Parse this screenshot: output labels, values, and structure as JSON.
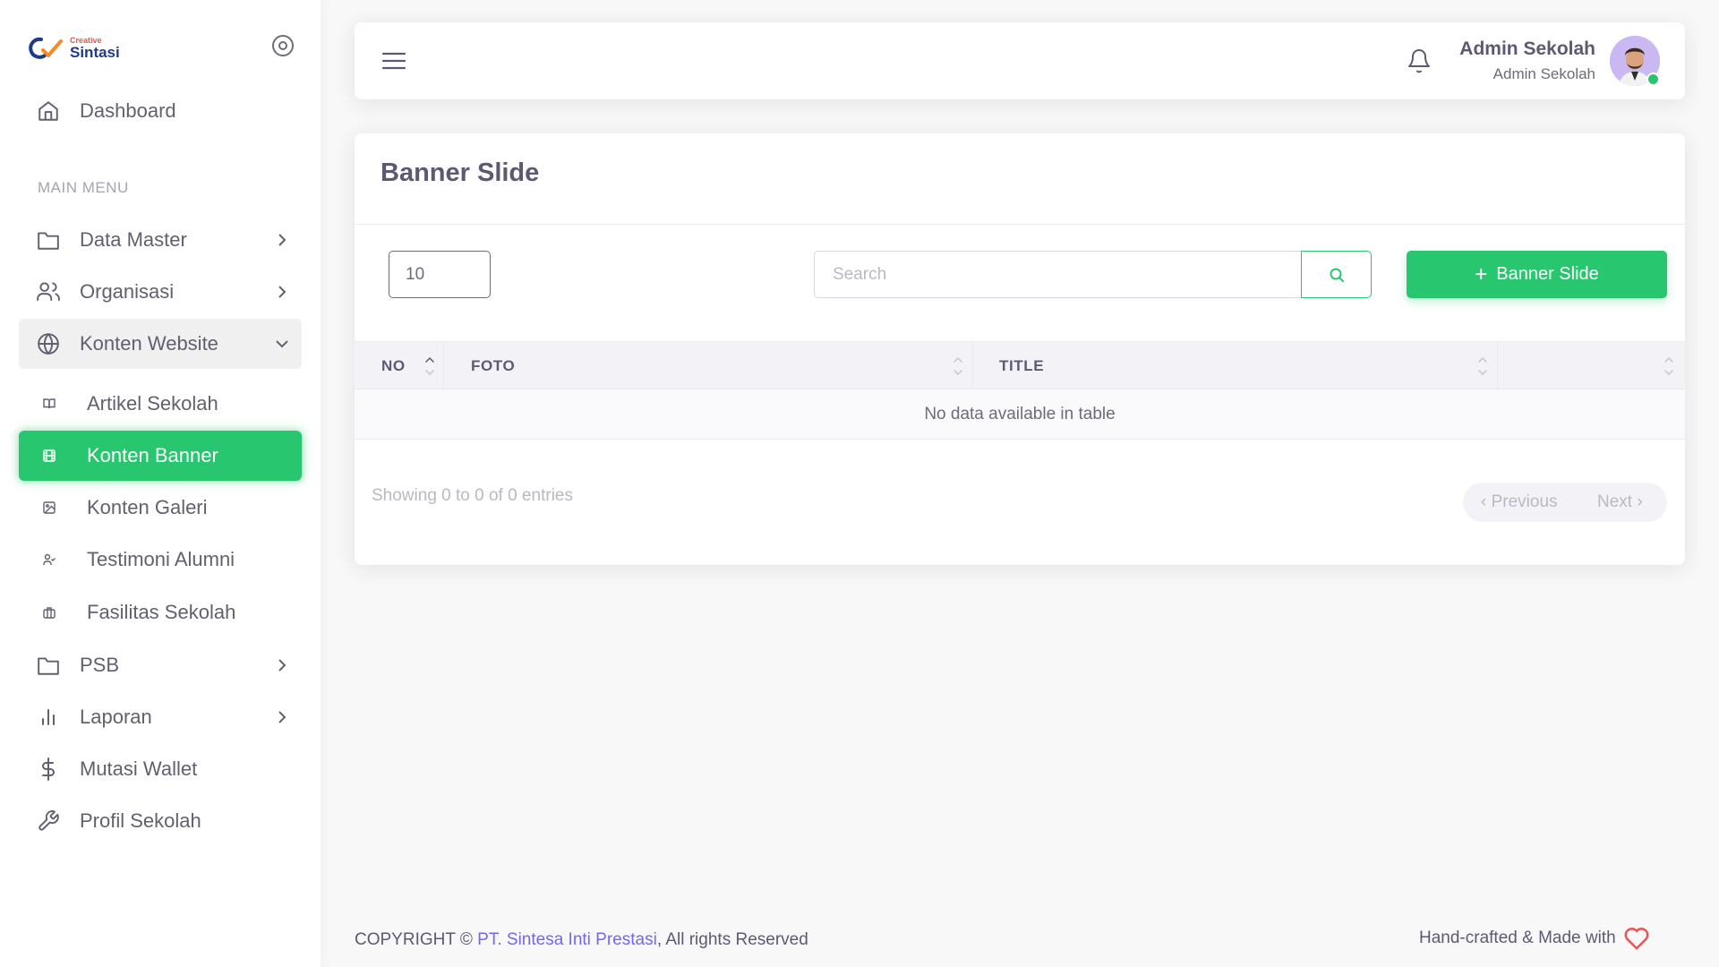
{
  "brand": {
    "small": "Creative",
    "name": "Sintasi"
  },
  "sidebar": {
    "dashboard": "Dashboard",
    "section": "MAIN MENU",
    "items": [
      {
        "label": "Data Master",
        "icon": "folder-icon"
      },
      {
        "label": "Organisasi",
        "icon": "users-icon"
      },
      {
        "label": "Konten Website",
        "icon": "globe-icon"
      },
      {
        "label": "Artikel Sekolah",
        "icon": "book-icon"
      },
      {
        "label": "Konten Banner",
        "icon": "film-icon"
      },
      {
        "label": "Konten Galeri",
        "icon": "image-icon"
      },
      {
        "label": "Testimoni Alumni",
        "icon": "user-check-icon"
      },
      {
        "label": "Fasilitas Sekolah",
        "icon": "briefcase-icon"
      },
      {
        "label": "PSB",
        "icon": "folder-icon"
      },
      {
        "label": "Laporan",
        "icon": "bar-chart-icon"
      },
      {
        "label": "Mutasi Wallet",
        "icon": "dollar-icon"
      },
      {
        "label": "Profil Sekolah",
        "icon": "tool-icon"
      }
    ]
  },
  "header": {
    "user_name": "Admin Sekolah",
    "user_role": "Admin Sekolah"
  },
  "main": {
    "title": "Banner Slide",
    "page_length": "10",
    "search_placeholder": "Search",
    "add_button": "Banner Slide",
    "columns": [
      "NO",
      "FOTO",
      "TITLE",
      ""
    ],
    "empty_message": "No data available in table",
    "info": "Showing 0 to 0 of 0 entries",
    "prev": "Previous",
    "next": "Next"
  },
  "footer": {
    "copyright": "COPYRIGHT ©",
    "company": "PT. Sintesa Inti Prestasi",
    "rights": ", All rights Reserved",
    "handcrafted": "Hand-crafted & Made with"
  },
  "colors": {
    "accent": "#28c76f",
    "link": "#7367f0",
    "heart": "#ea5455"
  }
}
